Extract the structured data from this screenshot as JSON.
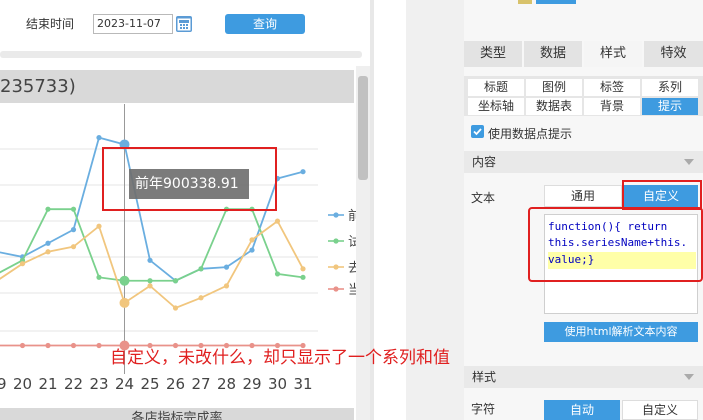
{
  "toolbar": {
    "end_time_label": "结束时间",
    "end_date_value": "2023-11-07",
    "query_button": "查询"
  },
  "chart": {
    "title_fragment": "235733)",
    "tooltip": "前年900338.91",
    "bottom_caption": "各店指标完成率",
    "legend_fragments": [
      "前",
      "试",
      "去",
      "当"
    ],
    "colors": {
      "series1": "#6aaee0",
      "series2": "#7ad18d",
      "series3": "#f1c67e",
      "series4": "#e9928a"
    }
  },
  "chart_data": {
    "type": "line",
    "x": [
      19,
      20,
      21,
      22,
      23,
      24,
      25,
      26,
      27,
      28,
      29,
      30,
      31
    ],
    "series": [
      {
        "name": "前",
        "values": [
          0.25,
          0.22,
          0.3,
          0.38,
          0.92,
          0.88,
          0.2,
          0.08,
          0.15,
          0.16,
          0.26,
          0.68,
          0.72
        ]
      },
      {
        "name": "试",
        "values": [
          0.12,
          0.2,
          0.5,
          0.5,
          0.1,
          0.08,
          0.08,
          0.08,
          0.15,
          0.5,
          0.5,
          0.12,
          0.1
        ]
      },
      {
        "name": "去",
        "values": [
          0.08,
          0.18,
          0.25,
          0.28,
          0.4,
          -0.05,
          0.05,
          -0.08,
          -0.02,
          0.05,
          0.32,
          0.43,
          0.15
        ]
      },
      {
        "name": "当",
        "values": [
          -0.3,
          -0.3,
          -0.3,
          -0.3,
          -0.3,
          -0.3,
          -0.3,
          -0.3,
          -0.3,
          -0.3,
          -0.3,
          -0.3,
          -0.3
        ]
      }
    ],
    "highlight_x": 24
  },
  "right_panel": {
    "tabs": [
      {
        "label": "类型",
        "active": false
      },
      {
        "label": "数据",
        "active": false
      },
      {
        "label": "样式",
        "active": true
      },
      {
        "label": "特效",
        "active": false
      }
    ],
    "subtabs_row1": [
      {
        "label": "标题",
        "active": false
      },
      {
        "label": "图例",
        "active": false
      },
      {
        "label": "标签",
        "active": false
      },
      {
        "label": "系列",
        "active": false
      }
    ],
    "subtabs_row2": [
      {
        "label": "坐标轴",
        "active": false
      },
      {
        "label": "数据表",
        "active": false
      },
      {
        "label": "背景",
        "active": false
      },
      {
        "label": "提示",
        "active": true
      }
    ],
    "use_tooltip_label": "使用数据点提示",
    "content_header": "内容",
    "text_label": "文本",
    "general_button": "通用",
    "custom_button": "自定义",
    "code_lines": [
      "function(){ return",
      "this.seriesName+this.",
      "value;}"
    ],
    "html_parse_button": "使用html解析文本内容",
    "style_header": "样式",
    "font_label": "字符",
    "auto_button": "自动",
    "custom_button2": "自定义"
  },
  "annotation_text": "自定义，未改什么，却只显示了一个系列和值"
}
